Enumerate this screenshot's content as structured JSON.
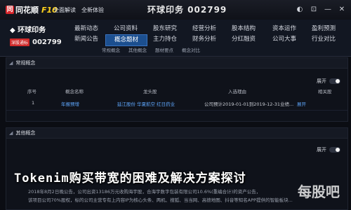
{
  "app": {
    "logo_text": "同花顺",
    "logo_suffix": "F10",
    "menu": [
      "全面解读",
      "全新体验"
    ],
    "stock_title": "环球印务 002799"
  },
  "window_buttons": [
    "◐",
    "⊡",
    "—",
    "✕"
  ],
  "nav": {
    "left_title": "◆ 环球印务",
    "badge": "深股通标",
    "code": "002799",
    "rows": [
      [
        "最新动态",
        "公司资料",
        "股东研究",
        "经营分析",
        "股本结构",
        "资本运作"
      ],
      [
        "新闻公告",
        "概念题材",
        "主力持仓",
        "财务分析",
        "分红融资",
        "公司大事"
      ],
      [
        "盈利预测",
        "",
        "",
        "",
        "",
        "行业对比"
      ]
    ],
    "subtabs": [
      "常规概念",
      "其他概念",
      "题材要点",
      "概念对比"
    ]
  },
  "section1": {
    "title": "常规概念",
    "toggle_label": "展开",
    "headers": [
      "序号",
      "概念名称",
      "龙头股",
      "入选理由",
      "相关股"
    ],
    "rows": [
      {
        "num": "1",
        "name": "年报预增",
        "leaders": "延江股份 华夏航空 红日药业",
        "reason": "公司预计2019-01-01到2019-12-31业绩...",
        "more": "展开"
      }
    ]
  },
  "section2": {
    "title": "其他概念",
    "toggle_label": "展开"
  },
  "article": {
    "title": "Tokenim购买带宽的困难及解决方案探讨",
    "line1": "2018年8月2日晚公告，公司出资13186万元收购海宇股，合海宇数字包装有限公司10.6%(重编合计)的资产公告，",
    "line2": "该项目公司70%股权，标的公司主营专有上内容IP为核心头条、两机、搜狐、当当网、高德地图、抖音等知名APP提供的智能板块...",
    "watermark": "每股吧"
  }
}
